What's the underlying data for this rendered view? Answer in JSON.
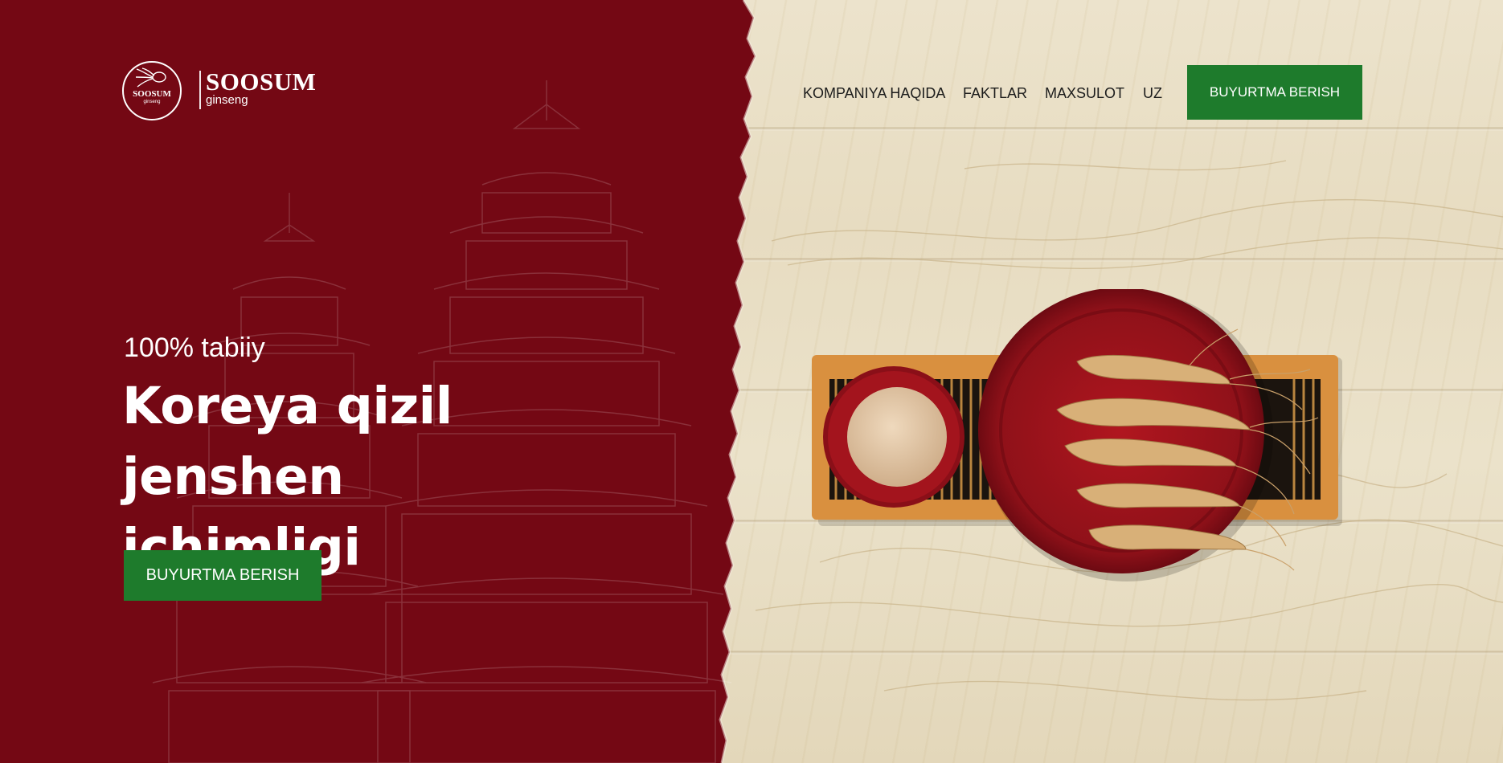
{
  "brand": {
    "seal_name": "SOOSUM",
    "seal_sub": "ginseng",
    "wordmark": "SOOSUM",
    "tagline": "ginseng"
  },
  "nav": {
    "items": [
      {
        "label": "KOMPANIYA HAQIDA"
      },
      {
        "label": "FAKTLAR"
      },
      {
        "label": "MAXSULOT"
      },
      {
        "label": "UZ"
      }
    ],
    "cta_label": "BUYURTMA BERISH"
  },
  "hero": {
    "subtitle": "100% tabiiy",
    "title_line1": "Koreya qizil jenshen",
    "title_line2": "ichimligi",
    "cta_label": "BUYURTMA BERISH"
  },
  "colors": {
    "panel_red": "#740814",
    "accent_green": "#1e7b2c",
    "wood_light": "#ece3cc",
    "tray_orange": "#d9903f",
    "plate_red": "#a3141d",
    "root_tan": "#d8b078"
  },
  "images": {
    "background": "pagoda-line-illustration",
    "product": "ginseng-roots-and-powder-on-red-plates"
  }
}
